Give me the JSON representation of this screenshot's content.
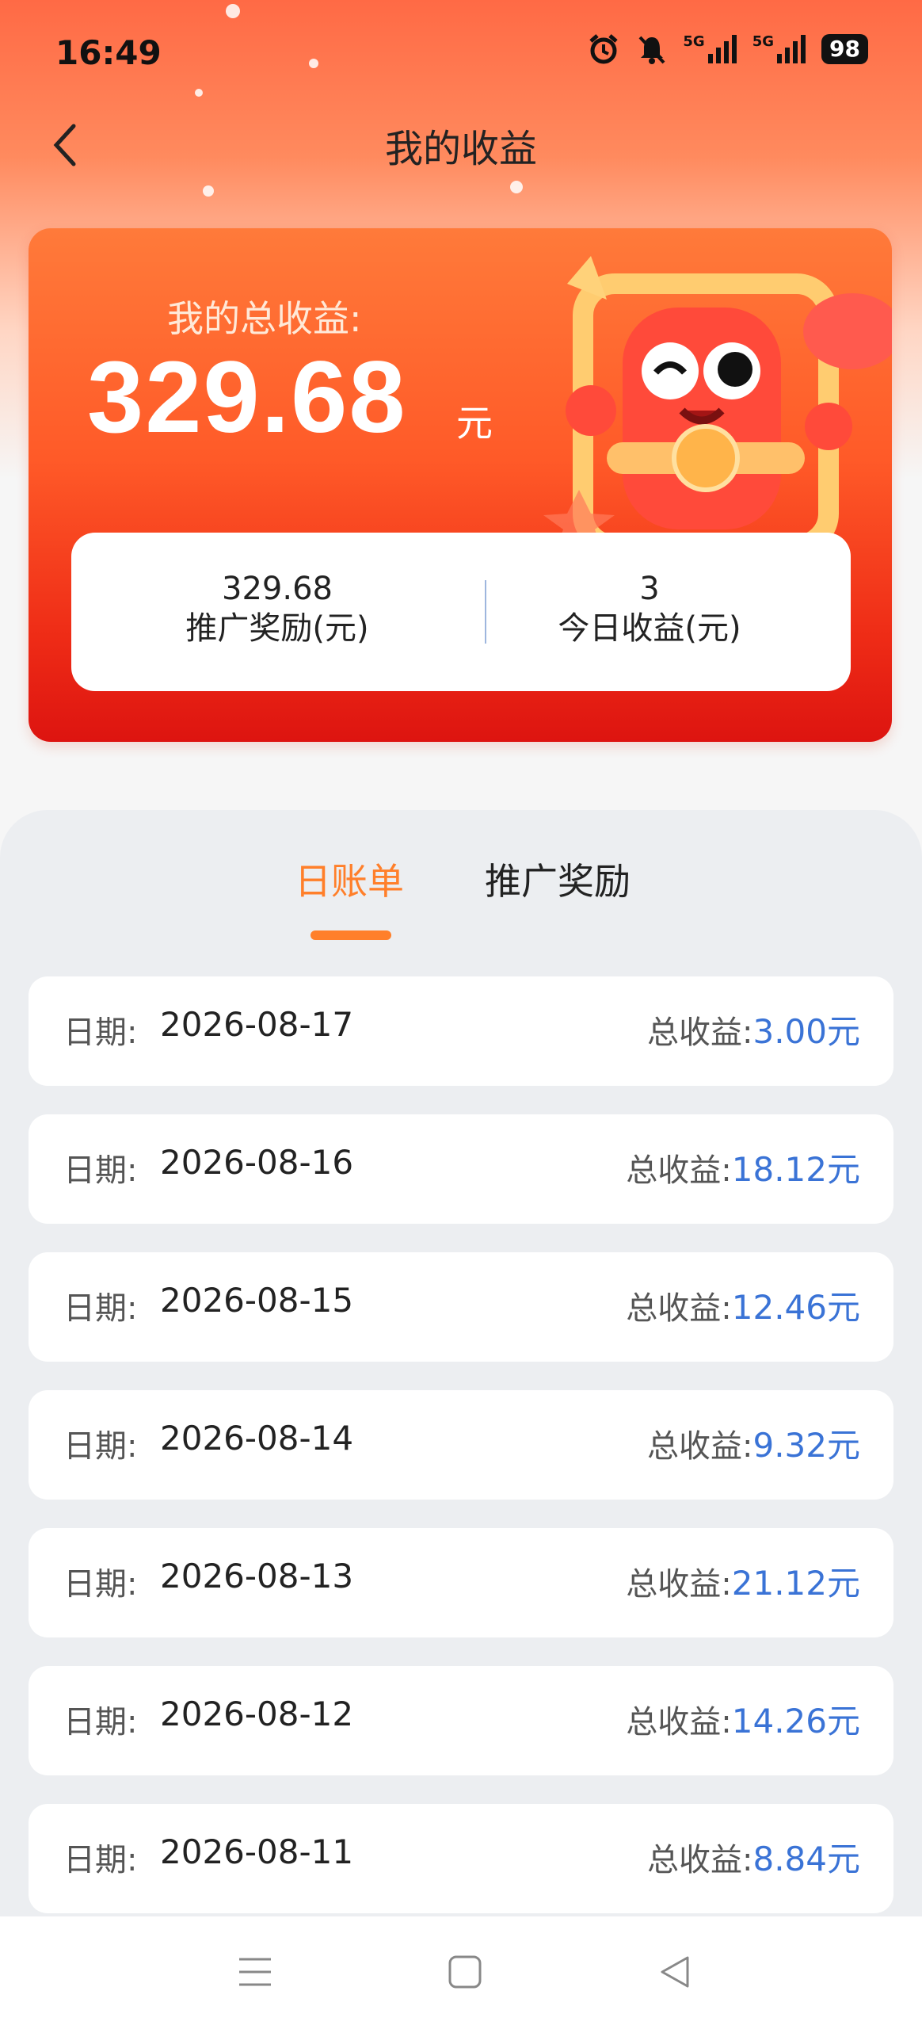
{
  "status_bar": {
    "time": "16:49",
    "signal_1": "5G",
    "signal_2": "5G",
    "battery": "98",
    "icons": [
      "alarm-icon",
      "mute-icon",
      "signal-icon",
      "signal-icon",
      "battery-icon"
    ]
  },
  "nav": {
    "title": "我的收益",
    "back_icon": "chevron-left-icon"
  },
  "summary": {
    "label": "我的总收益:",
    "amount": "329.68",
    "unit": "元",
    "promo_value": "329.68",
    "promo_label": "推广奖励(元)",
    "today_value": "3",
    "today_label": "今日收益(元)"
  },
  "tabs": [
    {
      "label": "日账单",
      "active": true
    },
    {
      "label": "推广奖励",
      "active": false
    }
  ],
  "records": [
    {
      "date_label": "日期:",
      "date": "2026-08-17",
      "total_label": "总收益:",
      "amount": "3.00元"
    },
    {
      "date_label": "日期:",
      "date": "2026-08-16",
      "total_label": "总收益:",
      "amount": "18.12元"
    },
    {
      "date_label": "日期:",
      "date": "2026-08-15",
      "total_label": "总收益:",
      "amount": "12.46元"
    },
    {
      "date_label": "日期:",
      "date": "2026-08-14",
      "total_label": "总收益:",
      "amount": "9.32元"
    },
    {
      "date_label": "日期:",
      "date": "2026-08-13",
      "total_label": "总收益:",
      "amount": "21.12元"
    },
    {
      "date_label": "日期:",
      "date": "2026-08-12",
      "total_label": "总收益:",
      "amount": "14.26元"
    },
    {
      "date_label": "日期:",
      "date": "2026-08-11",
      "total_label": "总收益:",
      "amount": "8.84元"
    }
  ],
  "system_nav": {
    "icons": [
      "menu-icon",
      "home-icon",
      "back-icon"
    ]
  },
  "colors": {
    "accent": "#ff7f2a",
    "amount_blue": "#3a73d6",
    "card_red": "#ee2b16"
  }
}
